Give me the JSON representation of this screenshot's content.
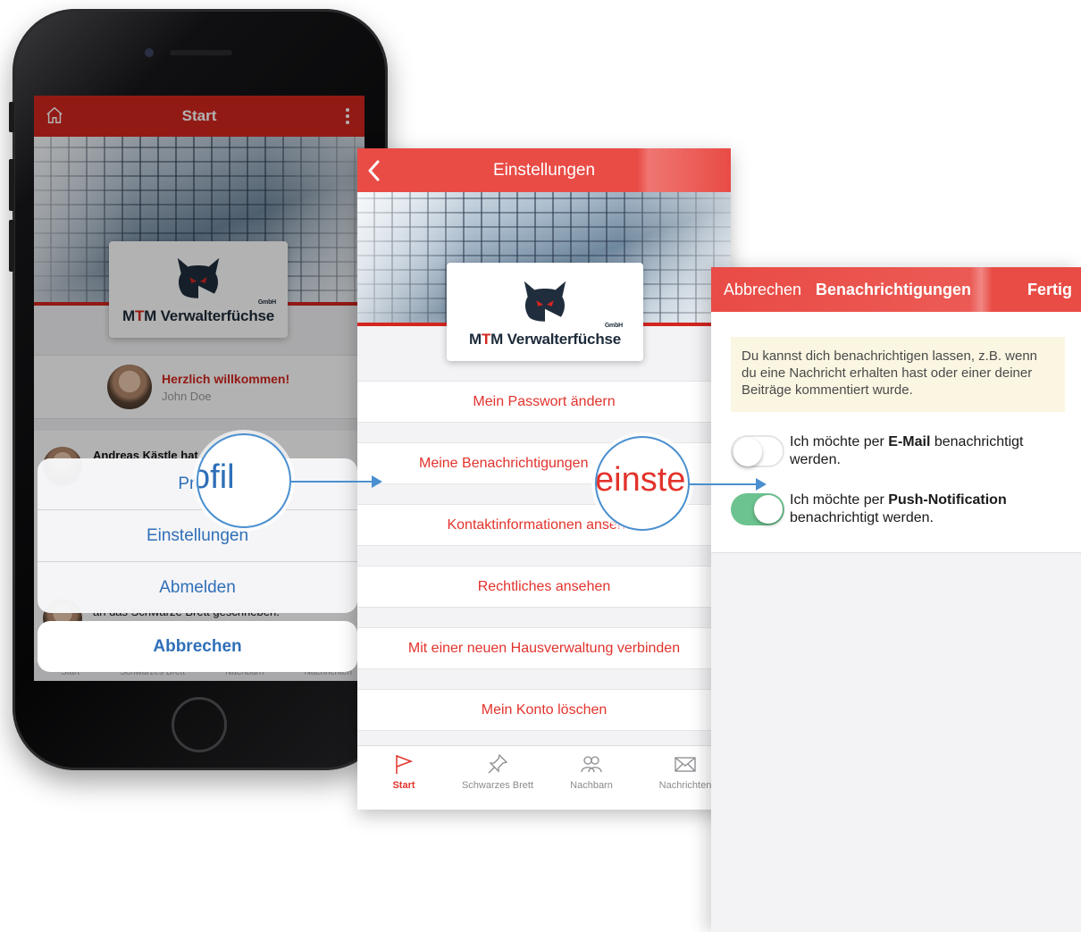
{
  "phone": {
    "header_title": "Start",
    "logo_text_pre": "M",
    "logo_text_red": "T",
    "logo_text_post": "M Verwalterfüchse",
    "logo_gmbh": "GmbH",
    "welcome_title": "Herzlich willkommen!",
    "welcome_name": "John Doe",
    "feed_author": "Andreas Kästle hat ... ag an",
    "feed_text": "an das Schwarze Brett geschrieben.",
    "action_sheet": [
      "Profil",
      "Einstellungen",
      "Abmelden"
    ],
    "cancel_label": "Abbrechen",
    "tabs": [
      "Start",
      "Schwarzes Brett",
      "Nachbarn",
      "Nachrichten"
    ]
  },
  "magnifier_profile": "ofil",
  "magnifier_settings": "einste",
  "settings": {
    "header_title": "Einstellungen",
    "menu": [
      "Mein Passwort ändern",
      "Meine Benachrichtigungen",
      "Kontaktinformationen ansehen",
      "Rechtliches ansehen",
      "Mit einer neuen Hausverwaltung verbinden",
      "Mein Konto löschen"
    ],
    "tabs": [
      "Start",
      "Schwarzes Brett",
      "Nachbarn",
      "Nachrichten"
    ]
  },
  "notifications": {
    "cancel_label": "Abbrechen",
    "title": "Benachrichtigungen",
    "done_label": "Fertig",
    "info": "Du kannst dich benachrichtigen lassen, z.B. wenn du eine Nachricht erhalten hast oder einer deiner Beiträge kommentiert wurde.",
    "email_pre": "Ich möchte per ",
    "email_bold": "E-Mail",
    "email_post": " benachrichtigt werden.",
    "email_enabled": false,
    "push_pre": "Ich möchte per ",
    "push_bold": "Push-Notification",
    "push_post": " benachrichtigt werden.",
    "push_enabled": true
  },
  "colors": {
    "brand_red": "#d2261f",
    "header_red": "#e94b45",
    "ios_blue": "#2f6fb8",
    "toggle_green": "#6cc38f"
  }
}
